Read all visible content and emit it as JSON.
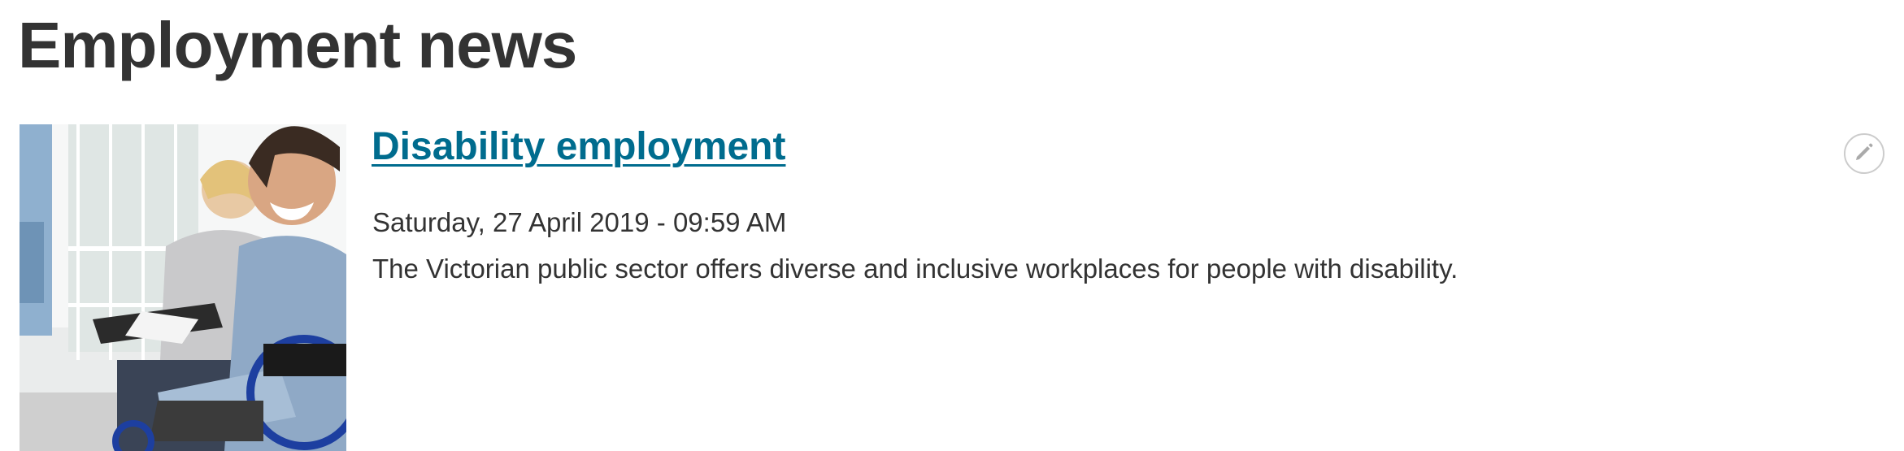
{
  "page": {
    "title": "Employment news"
  },
  "news_items": [
    {
      "title": "Disability employment",
      "date": "Saturday, 27 April 2019 - 09:59 AM",
      "summary": "The Victorian public sector offers diverse and inclusive workplaces for people with disability.",
      "image_icon": "photo-person-in-wheelchair"
    }
  ],
  "icons": {
    "edit": "pencil-icon"
  },
  "colors": {
    "link": "#006c8e",
    "text": "#333333",
    "edit_border": "#cccccc",
    "edit_icon": "#aaaaaa"
  }
}
